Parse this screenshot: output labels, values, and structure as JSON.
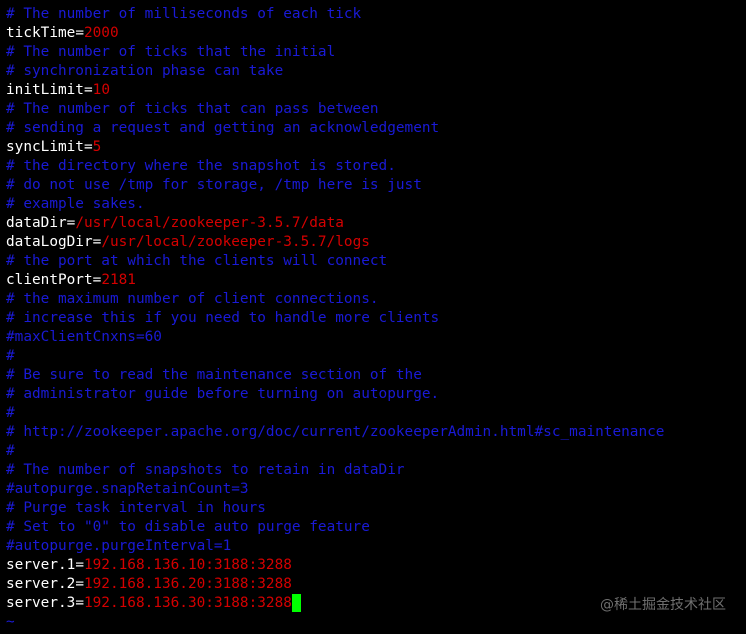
{
  "lines": [
    {
      "type": "comment",
      "text": "# The number of milliseconds of each tick"
    },
    {
      "type": "kv",
      "key": "tickTime",
      "value": "2000"
    },
    {
      "type": "comment",
      "text": "# The number of ticks that the initial"
    },
    {
      "type": "comment",
      "text": "# synchronization phase can take"
    },
    {
      "type": "kv",
      "key": "initLimit",
      "value": "10"
    },
    {
      "type": "comment",
      "text": "# The number of ticks that can pass between"
    },
    {
      "type": "comment",
      "text": "# sending a request and getting an acknowledgement"
    },
    {
      "type": "kv",
      "key": "syncLimit",
      "value": "5"
    },
    {
      "type": "comment",
      "text": "# the directory where the snapshot is stored."
    },
    {
      "type": "comment",
      "text": "# do not use /tmp for storage, /tmp here is just"
    },
    {
      "type": "comment",
      "text": "# example sakes."
    },
    {
      "type": "kv",
      "key": "dataDir",
      "value": "/usr/local/zookeeper-3.5.7/data"
    },
    {
      "type": "kv",
      "key": "dataLogDir",
      "value": "/usr/local/zookeeper-3.5.7/logs"
    },
    {
      "type": "comment",
      "text": "# the port at which the clients will connect"
    },
    {
      "type": "kv",
      "key": "clientPort",
      "value": "2181"
    },
    {
      "type": "comment",
      "text": "# the maximum number of client connections."
    },
    {
      "type": "comment",
      "text": "# increase this if you need to handle more clients"
    },
    {
      "type": "comment",
      "text": "#maxClientCnxns=60"
    },
    {
      "type": "comment",
      "text": "#"
    },
    {
      "type": "comment",
      "text": "# Be sure to read the maintenance section of the"
    },
    {
      "type": "comment",
      "text": "# administrator guide before turning on autopurge."
    },
    {
      "type": "comment",
      "text": "#"
    },
    {
      "type": "comment",
      "text": "# http://zookeeper.apache.org/doc/current/zookeeperAdmin.html#sc_maintenance"
    },
    {
      "type": "comment",
      "text": "#"
    },
    {
      "type": "comment",
      "text": "# The number of snapshots to retain in dataDir"
    },
    {
      "type": "comment",
      "text": "#autopurge.snapRetainCount=3"
    },
    {
      "type": "comment",
      "text": "# Purge task interval in hours"
    },
    {
      "type": "comment",
      "text": "# Set to \"0\" to disable auto purge feature"
    },
    {
      "type": "comment",
      "text": "#autopurge.purgeInterval=1"
    },
    {
      "type": "kv",
      "key": "server.1",
      "value": "192.168.136.10:3188:3288"
    },
    {
      "type": "kv",
      "key": "server.2",
      "value": "192.168.136.20:3188:3288"
    },
    {
      "type": "kv",
      "key": "server.3",
      "value": "192.168.136.30:3188:3288",
      "cursor": true
    },
    {
      "type": "tilde",
      "text": "~"
    }
  ],
  "eq": "=",
  "watermark": "@稀土掘金技术社区",
  "colors": {
    "background": "#000000",
    "comment": "#1a1ad6",
    "key": "#ffffff",
    "value": "#d40000",
    "cursor": "#00ff00"
  }
}
